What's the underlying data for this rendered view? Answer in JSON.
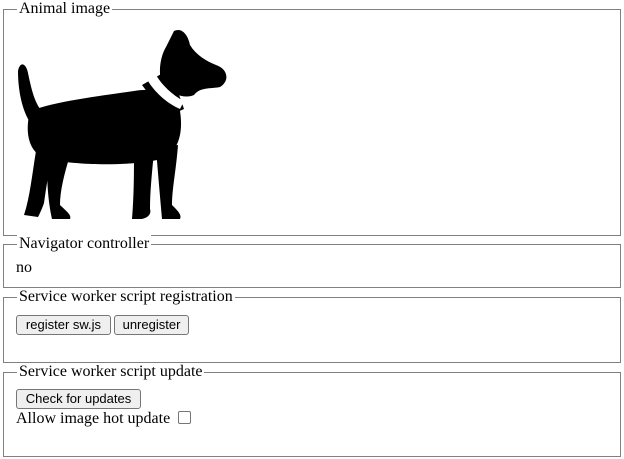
{
  "animal_section": {
    "legend": "Animal image",
    "image_icon": "dog-silhouette-icon"
  },
  "controller_section": {
    "legend": "Navigator controller",
    "value": "no"
  },
  "registration_section": {
    "legend": "Service worker script registration",
    "register_label": "register sw.js",
    "unregister_label": "unregister"
  },
  "update_section": {
    "legend": "Service worker script update",
    "check_label": "Check for updates",
    "hot_update_label": "Allow image hot update",
    "hot_update_checked": false
  }
}
